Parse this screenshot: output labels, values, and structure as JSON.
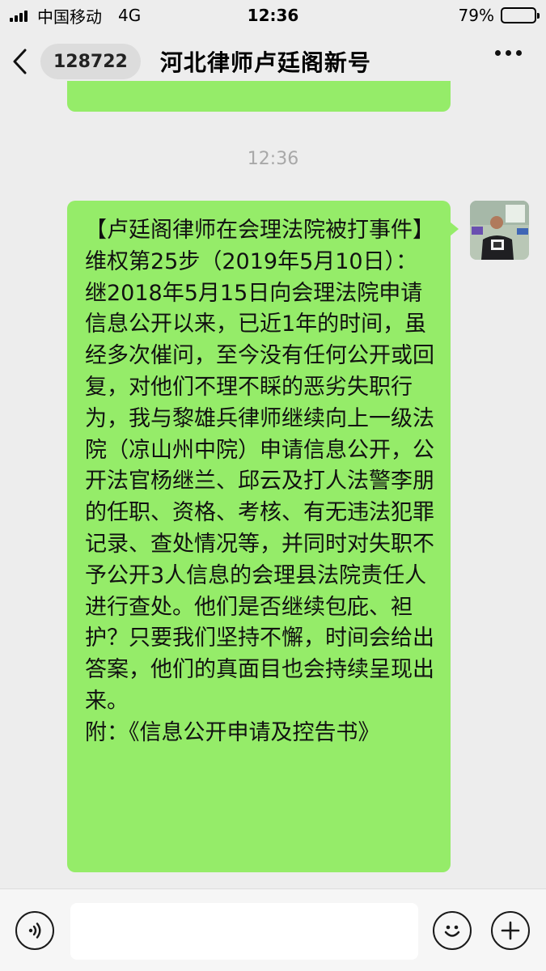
{
  "status_bar": {
    "carrier": "中国移动",
    "network": "4G",
    "time": "12:36",
    "battery_percent": "79%",
    "battery_level": 0.79
  },
  "nav": {
    "unread_count": "128722",
    "title": "河北律师卢廷阁新号"
  },
  "chat": {
    "timestamp": "12:36",
    "message": "【卢廷阁律师在会理法院被打事件】维权第25步（2019年5月10日）：\n继2018年5月15日向会理法院申请信息公开以来，已近1年的时间，虽经多次催问，至今没有任何公开或回复，对他们不理不睬的恶劣失职行为，我与黎雄兵律师继续向上一级法院（凉山州中院）申请信息公开，公开法官杨继兰、邱云及打人法警李朋的任职、资格、考核、有无违法犯罪记录、查处情况等，并同时对失职不予公开3人信息的会理县法院责任人进行查处。他们是否继续包庇、袒护？只要我们坚持不懈，时间会给出答案，他们的真面目也会持续呈现出来。\n附：《信息公开申请及控告书》",
    "bubble_color": "#95ec69"
  },
  "icons": {
    "back": "chevron-left-icon",
    "more": "more-dots-icon",
    "voice": "voice-icon",
    "emoji": "emoji-icon",
    "plus": "plus-icon"
  }
}
